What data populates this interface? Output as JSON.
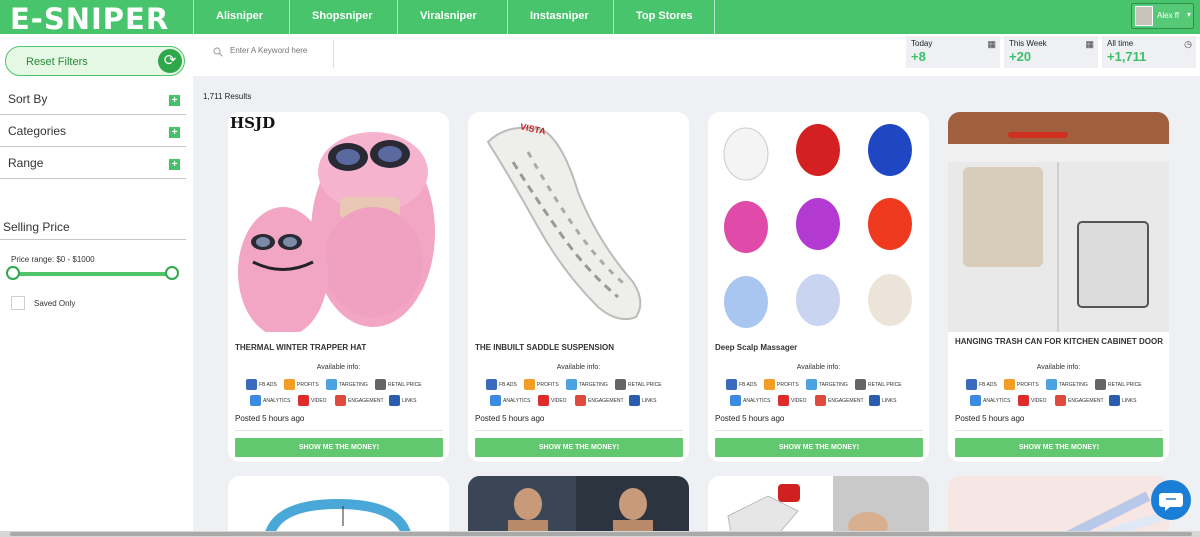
{
  "app": {
    "logo": "E-SNIPER"
  },
  "nav": {
    "tabs": [
      "Alisniper",
      "Shopsniper",
      "Viralsniper",
      "Instasniper",
      "Top Stores"
    ],
    "user": "Alex ff"
  },
  "sidebar": {
    "reset_label": "Reset Filters",
    "filters": [
      "Sort By",
      "Categories",
      "Range"
    ],
    "selling_price_title": "Selling Price",
    "price_range": "Price range: $0 - $1000",
    "saved_only": "Saved Only"
  },
  "search": {
    "placeholder": "Enter A Keyword here"
  },
  "stats": [
    {
      "label": "Today",
      "value": "+8",
      "icon": "calendar-icon"
    },
    {
      "label": "This Week",
      "value": "+20",
      "icon": "calendar-icon"
    },
    {
      "label": "All time",
      "value": "+1,711",
      "icon": "clock-icon"
    }
  ],
  "results_text": "1,711 Results",
  "card_common": {
    "available": "Available info:",
    "tags": [
      "FB ADS",
      "PROFITS",
      "TARGETING",
      "RETAIL PRICE",
      "ANALYTICS",
      "VIDEO",
      "ENGAGEMENT",
      "LINKS"
    ],
    "button": "SHOW ME THE MONEY!"
  },
  "products": [
    {
      "title": "THERMAL WINTER TRAPPER HAT",
      "posted": "Posted 5 hours ago",
      "brand": "HSJD"
    },
    {
      "title": "THE INBUILT SADDLE SUSPENSION",
      "posted": "Posted 5 hours ago",
      "brand": "VISTA"
    },
    {
      "title": "Deep Scalp Massager",
      "posted": "Posted 5 hours ago"
    },
    {
      "title": "HANGING TRASH CAN FOR KITCHEN CABINET DOOR",
      "posted": "Posted 5 hours ago"
    }
  ],
  "colors": {
    "brand_green": "#48c46c",
    "value_green": "#3ec06a",
    "button_green": "#62c86f",
    "chat_blue": "#1a7ed6"
  }
}
